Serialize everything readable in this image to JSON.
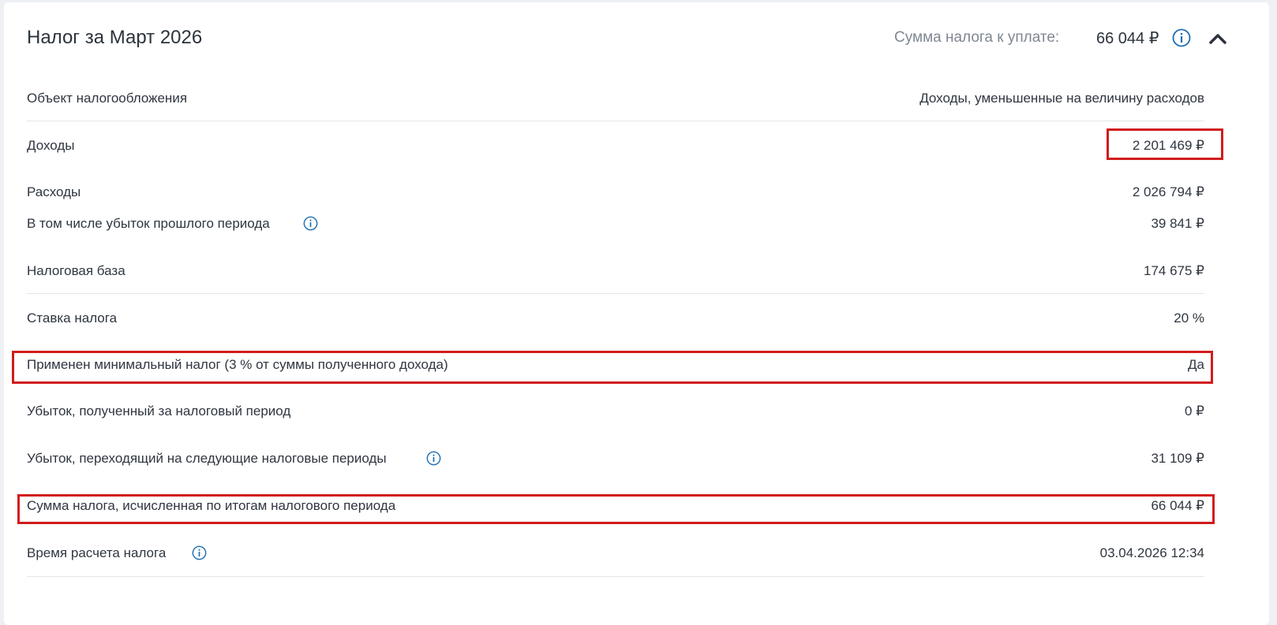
{
  "header": {
    "title": "Налог за Март 2026",
    "total_label": "Сумма налога к уплате:",
    "total_value": "66 044 ₽"
  },
  "rows": [
    {
      "label": "Объект налогообложения",
      "value": "Доходы, уменьшенные на величину расходов"
    },
    {
      "label": "Доходы",
      "value": "2 201 469 ₽"
    },
    {
      "label": "Расходы",
      "value": "2 026 794 ₽"
    },
    {
      "label": "В том числе убыток прошлого периода",
      "value": "39 841 ₽"
    },
    {
      "label": "Налоговая база",
      "value": "174 675 ₽"
    },
    {
      "label": "Ставка налога",
      "value": "20 %"
    },
    {
      "label": "Применен минимальный налог (3 % от суммы полученного дохода)",
      "value": "Да"
    },
    {
      "label": "Убыток, полученный за налоговый период",
      "value": "0 ₽"
    },
    {
      "label": "Убыток, переходящий на следующие налоговые периоды",
      "value": "31 109 ₽"
    },
    {
      "label": "Сумма налога, исчисленная по итогам налогового периода",
      "value": "66 044 ₽"
    },
    {
      "label": "Время расчета налога",
      "value": "03.04.2026 12:34"
    }
  ],
  "colors": {
    "accent": "#1f6fb2",
    "highlight": "#d11c1c",
    "divider": "#e3e6ea"
  },
  "icons": {
    "info": "info-icon",
    "collapse": "chevron-up-icon"
  }
}
